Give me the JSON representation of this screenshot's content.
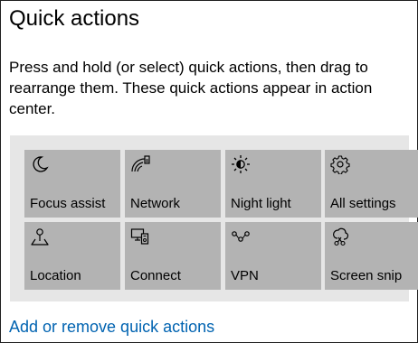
{
  "header": {
    "title": "Quick actions"
  },
  "description": "Press and hold (or select) quick actions, then drag to rearrange them. These quick actions appear in action center.",
  "tiles": [
    {
      "label": "Focus assist",
      "icon": "moon-icon"
    },
    {
      "label": "Network",
      "icon": "network-icon"
    },
    {
      "label": "Night light",
      "icon": "sun-icon"
    },
    {
      "label": "All settings",
      "icon": "gear-icon"
    },
    {
      "label": "Location",
      "icon": "location-icon"
    },
    {
      "label": "Connect",
      "icon": "connect-icon"
    },
    {
      "label": "VPN",
      "icon": "vpn-icon"
    },
    {
      "label": "Screen snip",
      "icon": "scissors-icon"
    }
  ],
  "footer": {
    "link_label": "Add or remove quick actions"
  },
  "colors": {
    "tile": "#b3b3b3",
    "panel": "#e6e6e6",
    "link": "#0063b1"
  }
}
